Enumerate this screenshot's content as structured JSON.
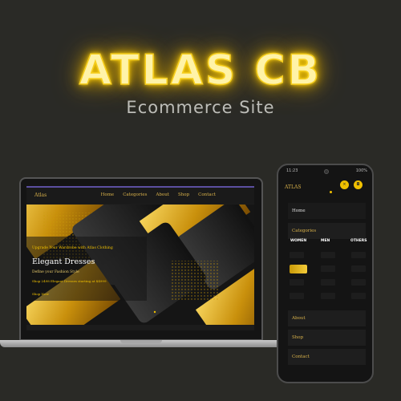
{
  "banner": {
    "title": "ATLAS CB",
    "subtitle": "Ecommerce Site"
  },
  "laptop": {
    "nav": {
      "brand": "Atlas",
      "links": [
        "Home",
        "Categories",
        "About",
        "Shop",
        "Contact"
      ]
    },
    "hero": {
      "kicker": "Upgrade Your Wardrobe with Atlas Clothing",
      "heading": "Elegant Dresses",
      "tagline": "Define your Fashion Style",
      "offer": "Shop 2498 Elegant Dresses starting at $4999",
      "cta": "Shop Now"
    }
  },
  "phone": {
    "status_time": "11:23",
    "status_battery": "100%",
    "brand": "ATLAS",
    "menu": {
      "home": "Home",
      "categories": "Categories",
      "about": "About",
      "shop": "Shop",
      "contact": "Contact"
    },
    "columns": [
      "WOMEN",
      "MEN",
      "OTHERS"
    ],
    "icons": [
      "close-icon",
      "cart-icon"
    ]
  },
  "colors": {
    "background": "#2a2a26",
    "gold": "#d8b14a",
    "neon": "#f7cf1e"
  }
}
